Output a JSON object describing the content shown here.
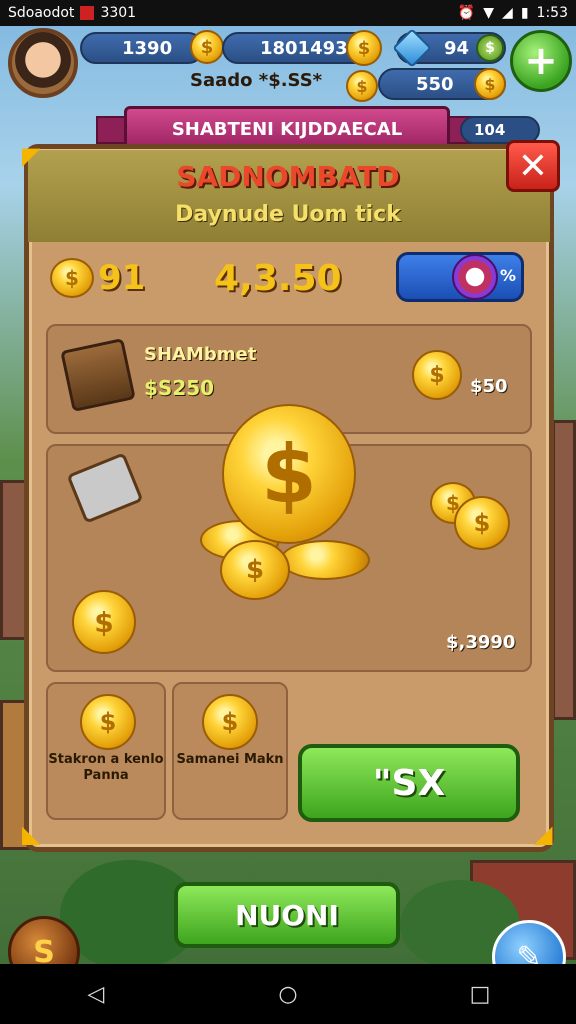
{
  "status_bar": {
    "left_text": "Sdoaodot",
    "left_value": "3301",
    "time": "1:53"
  },
  "hud": {
    "coins_value": "1390",
    "gold_value": "1801493",
    "gems_value": "94",
    "sub_label": "Saado *$.SS*",
    "sub_value": "550",
    "small_value": "104"
  },
  "ribbon": {
    "title": "SHABTENI KIJDDAECAL"
  },
  "panel": {
    "title": "SADNOMBATD",
    "subtitle": "Daynude Uom tick",
    "stat_left": "91",
    "stat_center": "4,3.50",
    "toggle_label": "%",
    "row1_title": "SHAMbmet",
    "row1_value": "$S250",
    "row1_right_value": "$50",
    "main_total": "$,3990",
    "item1_label": "Stakron a kenlo Panna",
    "item2_label": "Samanei Makn",
    "buy_label": "\"SX"
  },
  "bottom": {
    "main_button": "NUONI"
  },
  "colors": {
    "accent_green": "#3ea51e",
    "title_red": "#e9482b",
    "gold": "#f5c21a"
  },
  "icons": [
    "avatar",
    "coin-icon",
    "gem-icon",
    "plus-icon",
    "close-icon",
    "chest-icon",
    "ticket-icon",
    "coin-pile-icon",
    "shop-icon",
    "pencil-icon"
  ]
}
